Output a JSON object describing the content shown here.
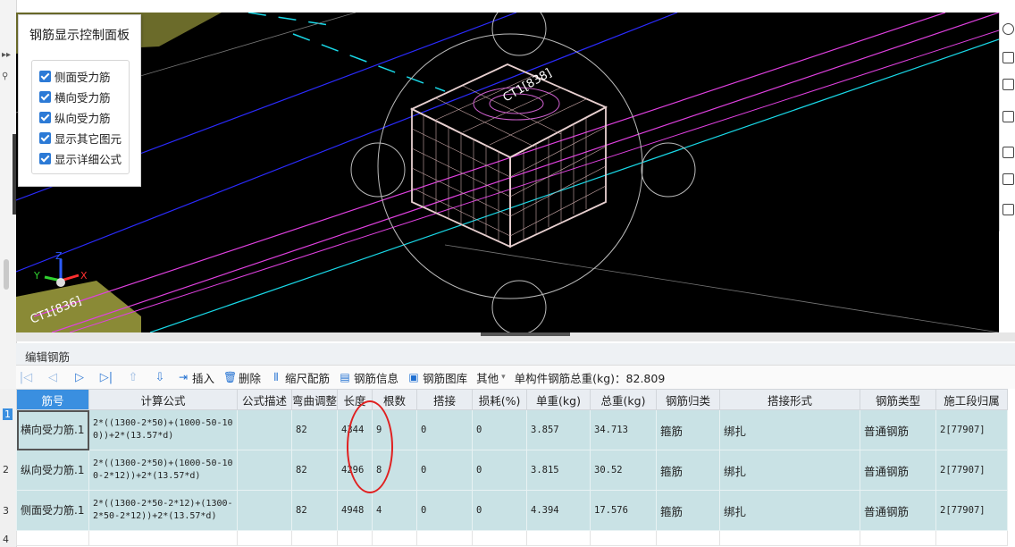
{
  "control_panel": {
    "title": "钢筋显示控制面板",
    "options": [
      {
        "label": "侧面受力筋",
        "checked": true
      },
      {
        "label": "横向受力筋",
        "checked": true
      },
      {
        "label": "纵向受力筋",
        "checked": true
      },
      {
        "label": "显示其它图元",
        "checked": true
      },
      {
        "label": "显示详细公式",
        "checked": true
      }
    ]
  },
  "viewport": {
    "labels": [
      "CT1[838]",
      "CT1[836]"
    ],
    "axes": {
      "x": "X",
      "y": "Y",
      "z": "Z"
    }
  },
  "edit_panel": {
    "title": "编辑钢筋",
    "toolbar": {
      "insert": "插入",
      "delete": "删除",
      "scale_rebar": "缩尺配筋",
      "rebar_info": "钢筋信息",
      "rebar_library": "钢筋图库",
      "other": "其他",
      "total_weight": "单构件钢筋总重(kg)：82.809"
    }
  },
  "table": {
    "headers": [
      "筋号",
      "计算公式",
      "公式描述",
      "弯曲调整",
      "长度",
      "根数",
      "搭接",
      "损耗(%)",
      "单重(kg)",
      "总重(kg)",
      "钢筋归类",
      "搭接形式",
      "钢筋类型",
      "施工段归属"
    ],
    "rows": [
      {
        "num": "1",
        "name": "横向受力筋.1",
        "formula": "2*((1300-2*50)+(1000-50-100))+2*(13.57*d)",
        "desc": "",
        "bend": "82",
        "length": "4344",
        "count": "9",
        "lap": "0",
        "loss": "0",
        "unit_weight": "3.857",
        "total_weight": "34.713",
        "category": "箍筋",
        "lap_form": "绑扎",
        "type": "普通钢筋",
        "segment": "2[77907]"
      },
      {
        "num": "2",
        "name": "纵向受力筋.1",
        "formula": "2*((1300-2*50)+(1000-50-100-2*12))+2*(13.57*d)",
        "desc": "",
        "bend": "82",
        "length": "4296",
        "count": "8",
        "lap": "0",
        "loss": "0",
        "unit_weight": "3.815",
        "total_weight": "30.52",
        "category": "箍筋",
        "lap_form": "绑扎",
        "type": "普通钢筋",
        "segment": "2[77907]"
      },
      {
        "num": "3",
        "name": "侧面受力筋.1",
        "formula": "2*((1300-2*50-2*12)+(1300-2*50-2*12))+2*(13.57*d)",
        "desc": "",
        "bend": "82",
        "length": "4948",
        "count": "4",
        "lap": "0",
        "loss": "0",
        "unit_weight": "4.394",
        "total_weight": "17.576",
        "category": "箍筋",
        "lap_form": "绑扎",
        "type": "普通钢筋",
        "segment": "2[77907]"
      }
    ],
    "next_row_num": "4"
  },
  "colors": {
    "accent": "#3a8fe0",
    "row_bg": "#c9e2e5",
    "annotation": "#e02020"
  }
}
